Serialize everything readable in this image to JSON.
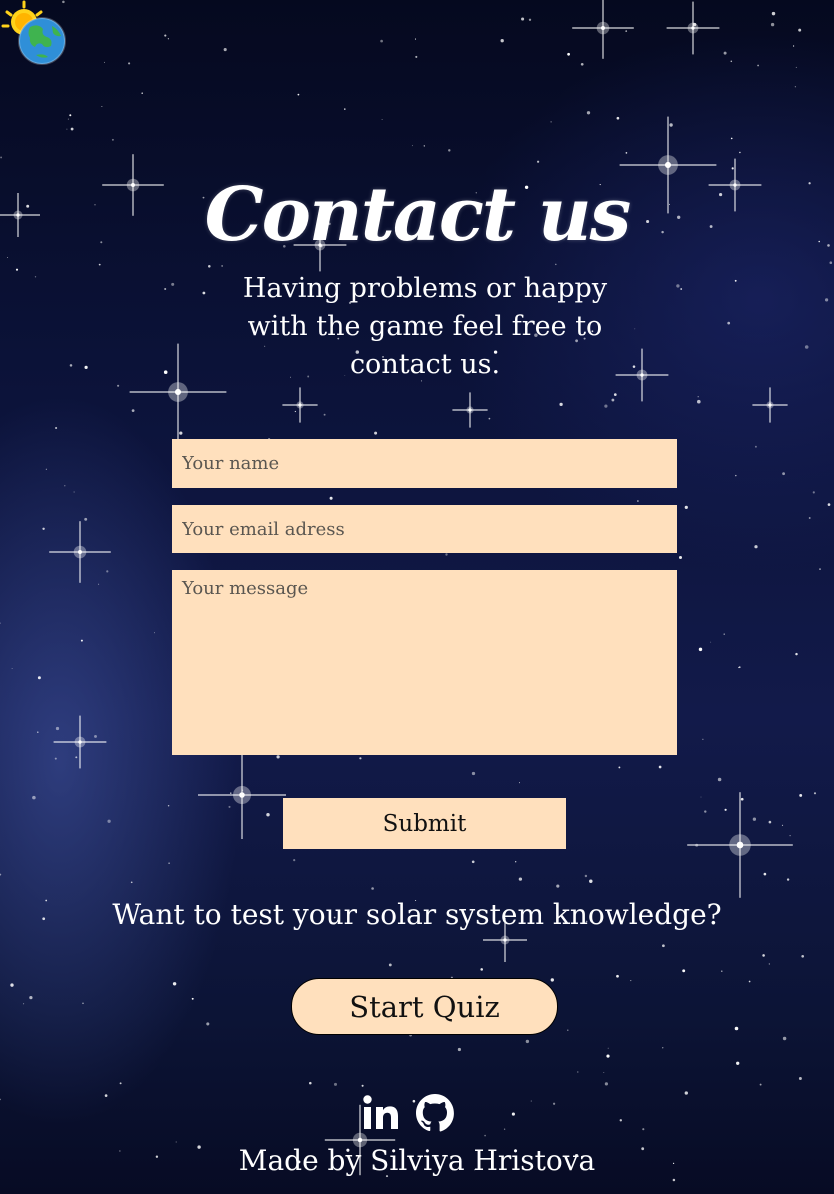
{
  "header": {
    "title": "Contact us"
  },
  "intro": {
    "text": "Having problems or happy with the game feel free to contact us."
  },
  "form": {
    "name_placeholder": "Your name",
    "email_placeholder": "Your email adress",
    "message_placeholder": "Your message",
    "submit_label": "Submit"
  },
  "quiz": {
    "prompt": "Want to test your solar system knowledge?",
    "button_label": "Start Quiz"
  },
  "social": {
    "icons": [
      "linkedin-icon",
      "github-icon"
    ]
  },
  "footer": {
    "credit": "Made by Silviya Hristova"
  },
  "colors": {
    "field_background": "#ffe0bd",
    "text": "#ffffff",
    "background": "#0b1238"
  },
  "logo": {
    "icons": [
      "sun-icon",
      "earth-icon"
    ]
  }
}
